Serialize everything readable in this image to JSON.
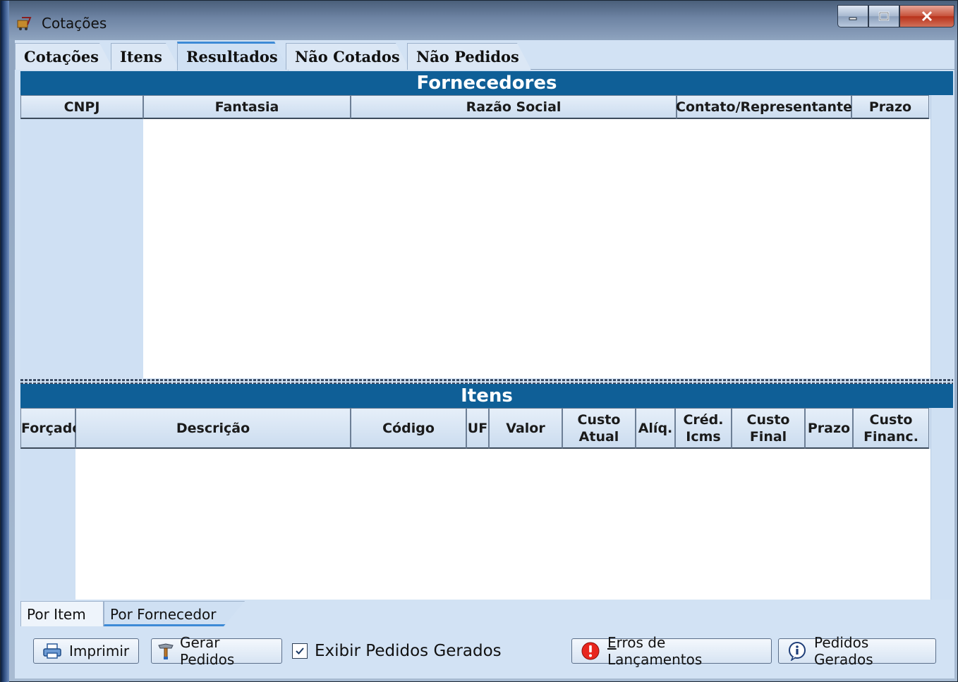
{
  "window": {
    "title": "Cotações",
    "controls": {
      "minimize": "minimize-icon",
      "maximize": "maximize-icon",
      "close": "close-icon"
    }
  },
  "top_tabs": [
    {
      "label": "Cotações",
      "active": false
    },
    {
      "label": "Itens",
      "active": false
    },
    {
      "label": "Resultados",
      "active": true
    },
    {
      "label": "Não Cotados",
      "active": false
    },
    {
      "label": "Não Pedidos",
      "active": false
    }
  ],
  "fornecedores": {
    "title": "Fornecedores",
    "columns": [
      "CNPJ",
      "Fantasia",
      "Razão Social",
      "Contato/Representante",
      "Prazo"
    ],
    "rows": []
  },
  "itens": {
    "title": "Itens",
    "columns": [
      "Forçado",
      "Descrição",
      "Código",
      "UF",
      "Valor",
      "Custo Atual",
      "Alíq.",
      "Créd. Icms",
      "Custo Final",
      "Prazo",
      "Custo Financ."
    ],
    "rows": []
  },
  "bottom_tabs": [
    {
      "label": "Por Item",
      "active": false
    },
    {
      "label": "Por Fornecedor",
      "active": true
    }
  ],
  "actions": {
    "imprimir": "Imprimir",
    "gerar_pedidos": "Gerar Pedidos",
    "exibir_pedidos_gerados": {
      "label": "Exibir Pedidos Gerados",
      "checked": true
    },
    "erros_lancamentos": "Erros de Lançamentos",
    "pedidos_gerados": "Pedidos Gerados"
  },
  "colors": {
    "section_header": "#0f5f97",
    "client_bg": "#d2e2f4",
    "active_tab_accent": "#3d8ad6"
  }
}
